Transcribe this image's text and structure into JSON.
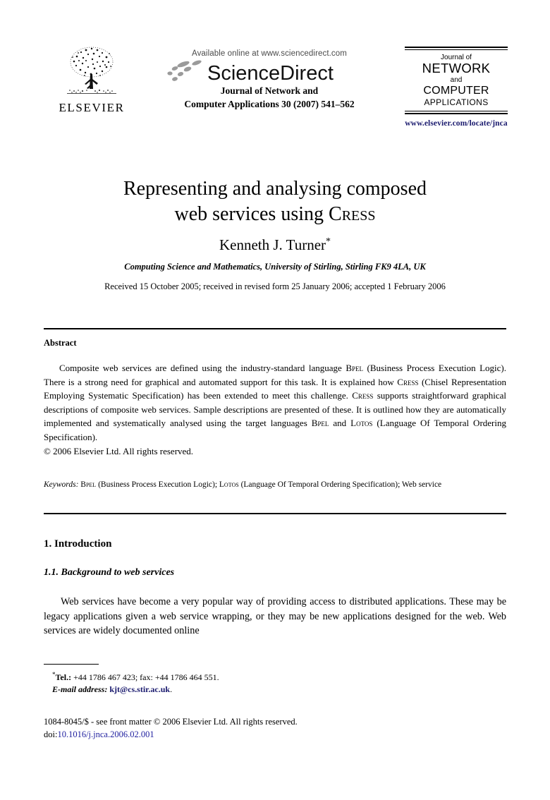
{
  "masthead": {
    "publisher": "ELSEVIER",
    "available_online": "Available online at www.sciencedirect.com",
    "sciencedirect_wordmark": "ScienceDirect",
    "journal_line1": "Journal of Network and",
    "journal_line2": "Computer Applications 30 (2007) 541–562",
    "journal_box": {
      "line1": "Journal of",
      "line2": "NETWORK",
      "line3": "and",
      "line4": "COMPUTER",
      "line5": "APPLICATIONS"
    },
    "journal_url": "www.elsevier.com/locate/jnca",
    "url_color": "#1a1a6e"
  },
  "article": {
    "title_line1": "Representing and analysing composed",
    "title_line2_a": "web services using ",
    "title_line2_smallcaps": "Cress",
    "author": "Kenneth J. Turner",
    "author_marker": "*",
    "affiliation": "Computing Science and Mathematics, University of Stirling, Stirling FK9 4LA, UK",
    "received": "Received 15 October 2005; received in revised form 25 January 2006; accepted 1 February 2006"
  },
  "abstract": {
    "heading": "Abstract",
    "paragraph_parts": {
      "p1_a": "Composite web services are defined using the industry-standard language ",
      "p1_bpel": "Bpel",
      "p1_b": " (Business Process Execution Logic). There is a strong need for graphical and automated support for this task. It is explained how ",
      "p1_cress1": "Cress",
      "p1_c": " (Chisel Representation Employing Systematic Specification) has been extended to meet this challenge. ",
      "p1_cress2": "Cress",
      "p1_d": " supports straightforward graphical descriptions of composite web services. Sample descriptions are presented of these. It is outlined how they are automatically implemented and systematically analysed using the target languages ",
      "p1_bpel2": "Bpel",
      "p1_e": " and ",
      "p1_lotos": "Lotos",
      "p1_f": " (Language Of Temporal Ordering Specification)."
    },
    "copyright": "© 2006 Elsevier Ltd. All rights reserved."
  },
  "keywords": {
    "label": "Keywords:",
    "parts": {
      "k_bpel": "Bpel",
      "k1": " (Business Process Execution Logic); ",
      "k_lotos": "Lotos",
      "k2": " (Language Of Temporal Ordering Specification); Web service"
    }
  },
  "sections": {
    "section1": "1.  Introduction",
    "section11": "1.1.  Background to web services",
    "body_paragraph": "Web services have become a very popular way of providing access to distributed applications. These may be legacy applications given a web service wrapping, or they may be new applications designed for the web. Web services are widely documented online"
  },
  "footnote": {
    "tel_label": "Tel.:",
    "tel_value": " +44 1786 467 423; fax: +44 1786 464 551.",
    "email_label": "E-mail address:",
    "email_value": "kjt@cs.stir.ac.uk",
    "email_color": "#1a1a6e"
  },
  "bottom": {
    "front_matter": "1084-8045/$ - see front matter © 2006 Elsevier Ltd. All rights reserved.",
    "doi_label": "doi:",
    "doi_value": "10.1016/j.jnca.2006.02.001",
    "doi_color": "#2222a0"
  }
}
